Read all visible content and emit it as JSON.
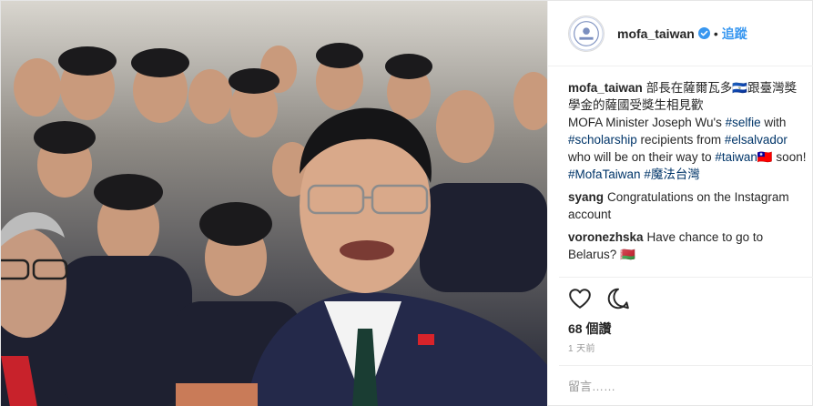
{
  "post": {
    "account": {
      "username": "mofa_taiwan",
      "verified": true,
      "separator": "•",
      "follow_label": "追蹤"
    },
    "caption": {
      "username": "mofa_taiwan",
      "line_zh": "部長在薩爾瓦多🇸🇻跟臺灣獎學金的薩國受獎生相見歡",
      "text_1": "MOFA Minister Joseph Wu's ",
      "tag_selfie": "#selfie",
      "text_2": " with ",
      "tag_scholarship": "#scholarship",
      "text_3": " recipients from ",
      "tag_elsalvador": "#elsalvador",
      "text_4": " who will be on their way to ",
      "tag_taiwan": "#taiwan",
      "text_5": "🇹🇼 soon!",
      "tag_mofa": "#MofaTaiwan",
      "tag_magic": "#魔法台灣"
    },
    "comments": [
      {
        "username": "syang",
        "text": "Congratulations on the Instagram account"
      },
      {
        "username": "voronezhska",
        "text": "Have chance to go to Belarus? 🇧🇾"
      }
    ],
    "actions": {
      "like_icon": "heart-icon",
      "comment_icon": "speech-bubble-icon"
    },
    "likes_label": "68 個讚",
    "timestamp": "1 天前",
    "add_comment_placeholder": "留言……",
    "more_icon": "ellipsis-icon"
  },
  "colors": {
    "link": "#003569",
    "follow": "#3897f0",
    "verified": "#3897f0",
    "muted": "#999999"
  }
}
